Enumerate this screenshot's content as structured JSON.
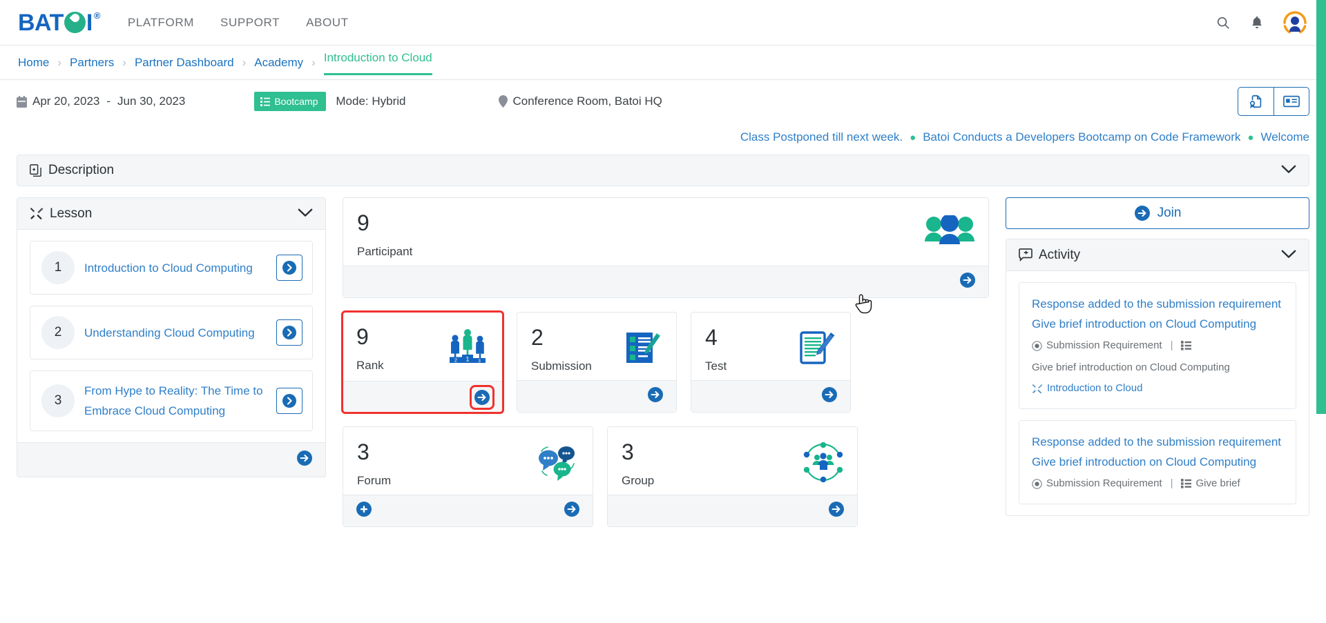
{
  "topnav": {
    "logo_text_1": "BAT",
    "logo_text_2": "I",
    "logo_reg": "®",
    "links": [
      {
        "label": "PLATFORM"
      },
      {
        "label": "SUPPORT"
      },
      {
        "label": "ABOUT"
      }
    ],
    "icons": {
      "search": "search-icon",
      "bell": "bell-icon",
      "avatar": "avatar-icon"
    }
  },
  "breadcrumb": {
    "items": [
      {
        "label": "Home",
        "active": false
      },
      {
        "label": "Partners",
        "active": false
      },
      {
        "label": "Partner Dashboard",
        "active": false
      },
      {
        "label": "Academy",
        "active": false
      },
      {
        "label": "Introduction to Cloud",
        "active": true
      }
    ],
    "separator": "›"
  },
  "infobar": {
    "date_start": "Apr 20, 2023",
    "date_dash": "-",
    "date_end": "Jun 30, 2023",
    "badge": "Bootcamp",
    "mode": "Mode: Hybrid",
    "location": "Conference Room, Batoi HQ",
    "actions": [
      {
        "name": "certificate-button"
      },
      {
        "name": "id-card-button"
      }
    ]
  },
  "ticker": {
    "items": [
      "Class Postponed till next week.",
      "Batoi Conducts a Developers Bootcamp on Code Framework",
      "Welcome"
    ],
    "dot": "●"
  },
  "description": {
    "title": "Description"
  },
  "lesson": {
    "title": "Lesson",
    "items": [
      {
        "number": "1",
        "title": "Introduction to Cloud Computing"
      },
      {
        "number": "2",
        "title": "Understanding Cloud Computing"
      },
      {
        "number": "3",
        "title": "From Hype to Reality: The Time to Embrace Cloud Computing"
      }
    ]
  },
  "cards": [
    {
      "count": "9",
      "label": "Participant",
      "art": "people-icon",
      "highlighted": false,
      "has_add": false
    },
    {
      "count": "9",
      "label": "Rank",
      "art": "podium-icon",
      "highlighted": true,
      "has_add": false
    },
    {
      "count": "2",
      "label": "Submission",
      "art": "checklist-icon",
      "highlighted": false,
      "has_add": false
    },
    {
      "count": "4",
      "label": "Test",
      "art": "document-pen-icon",
      "highlighted": false,
      "has_add": false
    },
    {
      "count": "3",
      "label": "Forum",
      "art": "chat-bubbles-icon",
      "highlighted": false,
      "has_add": true
    },
    {
      "count": "3",
      "label": "Group",
      "art": "group-network-icon",
      "highlighted": false,
      "has_add": false
    }
  ],
  "right": {
    "join_label": "Join",
    "activity_title": "Activity",
    "activities": [
      {
        "title": "Response added to the submission requirement Give brief introduction on Cloud Computing",
        "meta_type": "Submission Requirement",
        "meta_sep": "|",
        "meta_item": "Give brief introduction on Cloud Computing",
        "course": "Introduction to Cloud"
      },
      {
        "title": "Response added to the submission requirement Give brief introduction on Cloud Computing",
        "meta_type": "Submission Requirement",
        "meta_sep": "|",
        "meta_item": "Give brief",
        "course": ""
      }
    ]
  },
  "colors": {
    "brand_blue": "#1565c0",
    "brand_green": "#2fbf91",
    "link_blue": "#2f7fc8",
    "highlight_red": "#f0312e",
    "panel_gray": "#f4f6f8"
  }
}
